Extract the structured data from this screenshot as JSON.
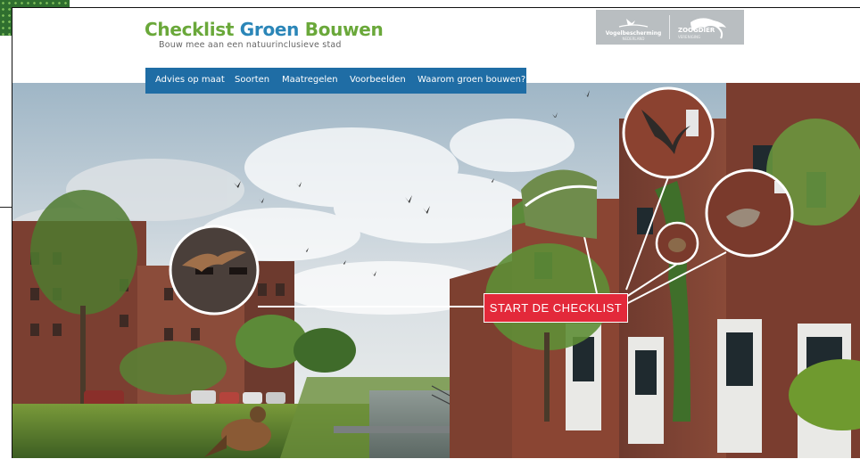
{
  "site": {
    "title_part1": "Checklist",
    "title_part2": "Groen",
    "title_part3": "Bouwen",
    "tagline": "Bouw mee aan een natuurinclusieve stad"
  },
  "nav": {
    "items": [
      {
        "label": "Advies op maat"
      },
      {
        "label": "Soorten"
      },
      {
        "label": "Maatregelen"
      },
      {
        "label": "Voorbeelden"
      },
      {
        "label": "Waarom groen bouwen?"
      }
    ]
  },
  "partners": [
    {
      "name": "Vogelbescherming",
      "subtitle": "NEDERLAND"
    },
    {
      "name": "ZOOGDIER",
      "subtitle": "VERENIGING"
    }
  ],
  "hero": {
    "cta_label": "START DE CHECKLIST"
  },
  "colors": {
    "green": "#6aa83a",
    "blue": "#2b86b8",
    "nav": "#1f6da5",
    "cta": "#e3293a"
  }
}
